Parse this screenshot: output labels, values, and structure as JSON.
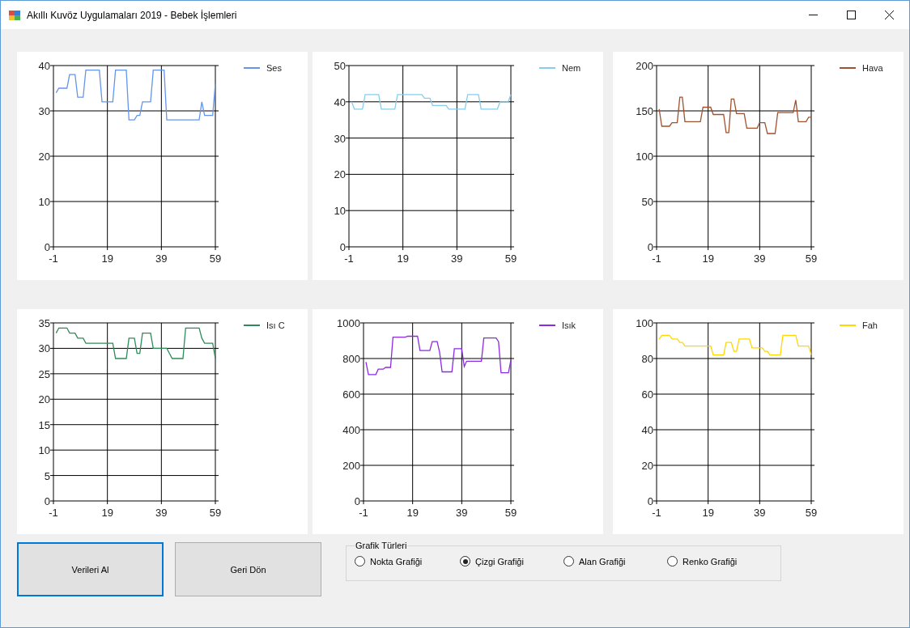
{
  "window": {
    "title": "Akıllı Kuvöz Uygulamaları 2019 - Bebek İşlemleri"
  },
  "charts": [
    {
      "chart_data": {
        "type": "line",
        "x": [
          0,
          1,
          2,
          3,
          4,
          5,
          6,
          7,
          8,
          9,
          10,
          11,
          12,
          13,
          14,
          15,
          16,
          17,
          18,
          19,
          20,
          21,
          22,
          23,
          24,
          25,
          26,
          27,
          28,
          29,
          30,
          31,
          32,
          33,
          34,
          35,
          36,
          37,
          38,
          39,
          40,
          41,
          42,
          43,
          44,
          45,
          46,
          47,
          48,
          49,
          50,
          51,
          52,
          53,
          54,
          55,
          56,
          57,
          58,
          59
        ],
        "xlim": [
          -1,
          59
        ],
        "ylim": [
          0,
          40
        ],
        "grid": true,
        "xticks": [
          -1,
          19,
          39,
          59
        ],
        "yticks": [
          0,
          10,
          20,
          30,
          40
        ],
        "series": [
          {
            "name": "Ses",
            "color": "#6495ed",
            "values": [
              34,
              35,
              35,
              35,
              35,
              38,
              38,
              38,
              33,
              33,
              33,
              39,
              39,
              39,
              39,
              39,
              39,
              32,
              32,
              32,
              32,
              32,
              39,
              39,
              39,
              39,
              39,
              28,
              28,
              28,
              29,
              29,
              32,
              32,
              32,
              32,
              39,
              39,
              39,
              39,
              39,
              28,
              28,
              28,
              28,
              28,
              28,
              28,
              28,
              28,
              28,
              28,
              28,
              28,
              32,
              29,
              29,
              29,
              29,
              36
            ]
          }
        ]
      }
    },
    {
      "chart_data": {
        "type": "line",
        "x": [
          0,
          1,
          2,
          3,
          4,
          5,
          6,
          7,
          8,
          9,
          10,
          11,
          12,
          13,
          14,
          15,
          16,
          17,
          18,
          19,
          20,
          21,
          22,
          23,
          24,
          25,
          26,
          27,
          28,
          29,
          30,
          31,
          32,
          33,
          34,
          35,
          36,
          37,
          38,
          39,
          40,
          41,
          42,
          43,
          44,
          45,
          46,
          47,
          48,
          49,
          50,
          51,
          52,
          53,
          54,
          55,
          56,
          57,
          58,
          59
        ],
        "xlim": [
          -1,
          59
        ],
        "ylim": [
          0,
          50
        ],
        "grid": true,
        "xticks": [
          -1,
          19,
          39,
          59
        ],
        "yticks": [
          0,
          10,
          20,
          30,
          40,
          50
        ],
        "series": [
          {
            "name": "Nem",
            "color": "#87ceeb",
            "values": [
              40,
              38,
              38,
              38,
              38,
              42,
              42,
              42,
              42,
              42,
              42,
              38,
              38,
              38,
              38,
              38,
              38,
              42,
              42,
              42,
              42,
              42,
              42,
              42,
              42,
              42,
              42,
              41,
              41,
              41,
              39,
              39,
              39,
              39,
              39,
              39,
              38,
              38,
              38,
              38,
              38,
              38,
              38,
              42,
              42,
              42,
              42,
              42,
              38,
              38,
              38,
              38,
              38,
              38,
              38,
              40,
              40,
              40,
              40,
              42
            ]
          }
        ]
      }
    },
    {
      "chart_data": {
        "type": "line",
        "x": [
          0,
          1,
          2,
          3,
          4,
          5,
          6,
          7,
          8,
          9,
          10,
          11,
          12,
          13,
          14,
          15,
          16,
          17,
          18,
          19,
          20,
          21,
          22,
          23,
          24,
          25,
          26,
          27,
          28,
          29,
          30,
          31,
          32,
          33,
          34,
          35,
          36,
          37,
          38,
          39,
          40,
          41,
          42,
          43,
          44,
          45,
          46,
          47,
          48,
          49,
          50,
          51,
          52,
          53,
          54,
          55,
          56,
          57,
          58,
          59
        ],
        "xlim": [
          -1,
          59
        ],
        "ylim": [
          0,
          200
        ],
        "grid": true,
        "xticks": [
          -1,
          19,
          39,
          59
        ],
        "yticks": [
          0,
          50,
          100,
          150,
          200
        ],
        "series": [
          {
            "name": "Hava",
            "color": "#a0522d",
            "values": [
              152,
              133,
              133,
              133,
              133,
              137,
              137,
              137,
              165,
              165,
              138,
              138,
              138,
              138,
              138,
              138,
              138,
              154,
              154,
              154,
              154,
              146,
              146,
              146,
              146,
              146,
              126,
              126,
              163,
              163,
              147,
              147,
              147,
              147,
              131,
              131,
              131,
              131,
              131,
              137,
              137,
              137,
              125,
              125,
              125,
              125,
              148,
              148,
              148,
              148,
              148,
              148,
              148,
              162,
              138,
              138,
              138,
              138,
              143,
              143
            ]
          }
        ]
      }
    },
    {
      "chart_data": {
        "type": "line",
        "x": [
          0,
          1,
          2,
          3,
          4,
          5,
          6,
          7,
          8,
          9,
          10,
          11,
          12,
          13,
          14,
          15,
          16,
          17,
          18,
          19,
          20,
          21,
          22,
          23,
          24,
          25,
          26,
          27,
          28,
          29,
          30,
          31,
          32,
          33,
          34,
          35,
          36,
          37,
          38,
          39,
          40,
          41,
          42,
          43,
          44,
          45,
          46,
          47,
          48,
          49,
          50,
          51,
          52,
          53,
          54,
          55,
          56,
          57,
          58,
          59
        ],
        "xlim": [
          -1,
          59
        ],
        "ylim": [
          0,
          35
        ],
        "grid": true,
        "xticks": [
          -1,
          19,
          39,
          59
        ],
        "yticks": [
          0,
          5,
          10,
          15,
          20,
          25,
          30,
          35
        ],
        "series": [
          {
            "name": "Isı C",
            "color": "#2e8b57",
            "values": [
              33,
              34,
              34,
              34,
              34,
              33,
              33,
              33,
              32,
              32,
              32,
              31,
              31,
              31,
              31,
              31,
              31,
              31,
              31,
              31,
              31,
              31,
              28,
              28,
              28,
              28,
              28,
              32,
              32,
              32,
              29,
              29,
              33,
              33,
              33,
              33,
              30,
              30,
              30,
              30,
              30,
              30,
              29,
              28,
              28,
              28,
              28,
              28,
              34,
              34,
              34,
              34,
              34,
              34,
              32,
              31,
              31,
              31,
              31,
              28
            ]
          }
        ]
      }
    },
    {
      "chart_data": {
        "type": "line",
        "x": [
          0,
          1,
          2,
          3,
          4,
          5,
          6,
          7,
          8,
          9,
          10,
          11,
          12,
          13,
          14,
          15,
          16,
          17,
          18,
          19,
          20,
          21,
          22,
          23,
          24,
          25,
          26,
          27,
          28,
          29,
          30,
          31,
          32,
          33,
          34,
          35,
          36,
          37,
          38,
          39,
          40,
          41,
          42,
          43,
          44,
          45,
          46,
          47,
          48,
          49,
          50,
          51,
          52,
          53,
          54,
          55,
          56,
          57,
          58,
          59
        ],
        "xlim": [
          -1,
          59
        ],
        "ylim": [
          0,
          1000
        ],
        "grid": true,
        "xticks": [
          -1,
          19,
          39,
          59
        ],
        "yticks": [
          0,
          200,
          400,
          600,
          800,
          1000
        ],
        "series": [
          {
            "name": "Isık",
            "color": "#8a2be2",
            "values": [
              780,
              710,
              710,
              710,
              710,
              740,
              740,
              740,
              750,
              750,
              750,
              920,
              920,
              920,
              920,
              920,
              920,
              925,
              925,
              925,
              925,
              925,
              845,
              845,
              845,
              845,
              845,
              895,
              895,
              895,
              835,
              725,
              725,
              725,
              725,
              725,
              855,
              855,
              855,
              855,
              755,
              785,
              785,
              785,
              785,
              785,
              785,
              785,
              915,
              915,
              915,
              915,
              915,
              915,
              895,
              720,
              720,
              720,
              720,
              790
            ]
          }
        ]
      }
    },
    {
      "chart_data": {
        "type": "line",
        "x": [
          0,
          1,
          2,
          3,
          4,
          5,
          6,
          7,
          8,
          9,
          10,
          11,
          12,
          13,
          14,
          15,
          16,
          17,
          18,
          19,
          20,
          21,
          22,
          23,
          24,
          25,
          26,
          27,
          28,
          29,
          30,
          31,
          32,
          33,
          34,
          35,
          36,
          37,
          38,
          39,
          40,
          41,
          42,
          43,
          44,
          45,
          46,
          47,
          48,
          49,
          50,
          51,
          52,
          53,
          54,
          55,
          56,
          57,
          58,
          59
        ],
        "xlim": [
          -1,
          59
        ],
        "ylim": [
          0,
          100
        ],
        "grid": true,
        "xticks": [
          -1,
          19,
          39,
          59
        ],
        "yticks": [
          0,
          20,
          40,
          60,
          80,
          100
        ],
        "series": [
          {
            "name": "Fah",
            "color": "#ffd700",
            "values": [
              91,
              93,
              93,
              93,
              93,
              91,
              91,
              91,
              89,
              89,
              87,
              87,
              87,
              87,
              87,
              87,
              87,
              87,
              87,
              87,
              87,
              82,
              82,
              82,
              82,
              82,
              89,
              89,
              89,
              84,
              84,
              91,
              91,
              91,
              91,
              91,
              86,
              86,
              86,
              86,
              86,
              84,
              84,
              82,
              82,
              82,
              82,
              82,
              93,
              93,
              93,
              93,
              93,
              93,
              87,
              87,
              87,
              87,
              87,
              82
            ]
          }
        ]
      }
    }
  ],
  "buttons": [
    {
      "label": "Verileri Al",
      "focused": true
    },
    {
      "label": "Geri Dön",
      "focused": false
    }
  ],
  "chart_types": {
    "title": "Grafik Türleri",
    "options": [
      {
        "label": "Nokta Grafiği",
        "selected": false
      },
      {
        "label": "Çizgi Grafiği",
        "selected": true
      },
      {
        "label": "Alan Grafiği",
        "selected": false
      },
      {
        "label": "Renko Grafiği",
        "selected": false
      }
    ]
  }
}
